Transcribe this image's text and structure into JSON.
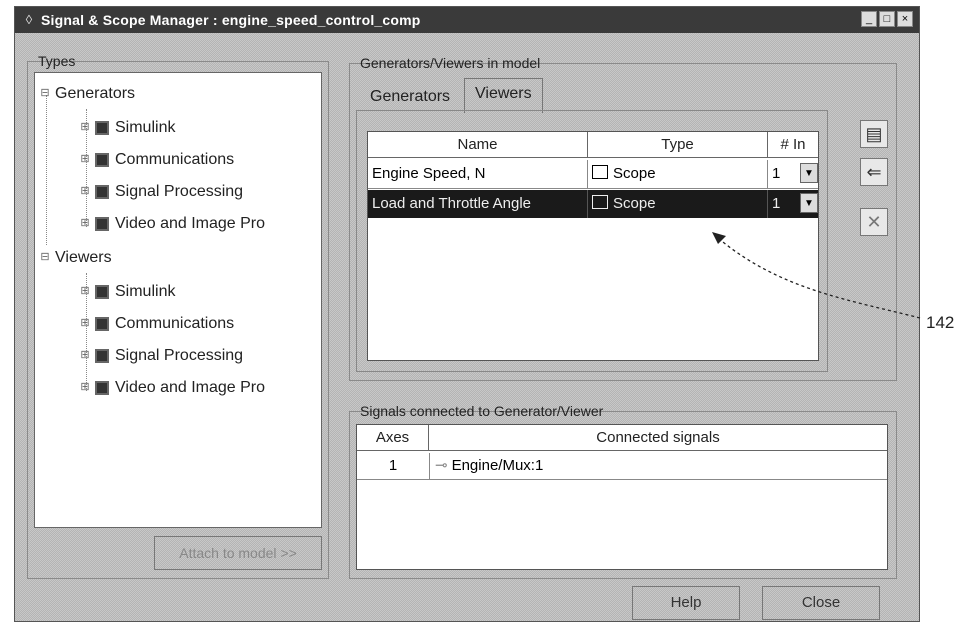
{
  "window": {
    "title": "Signal & Scope Manager : engine_speed_control_comp"
  },
  "types": {
    "legend": "Types",
    "tree": [
      {
        "label": "Generators",
        "children": [
          "Simulink",
          "Communications",
          "Signal Processing",
          "Video and Image Pro"
        ]
      },
      {
        "label": "Viewers",
        "children": [
          "Simulink",
          "Communications",
          "Signal Processing",
          "Video and Image Pro"
        ]
      }
    ],
    "attach_label": "Attach to model >>"
  },
  "gv": {
    "legend": "Generators/Viewers in model",
    "tabs": [
      "Generators",
      "Viewers"
    ],
    "active_tab": "Viewers",
    "columns": [
      "Name",
      "Type",
      "# In"
    ],
    "rows": [
      {
        "name": "Engine Speed, N",
        "type": "Scope",
        "in": "1",
        "selected": false
      },
      {
        "name": "Load and Throttle Angle",
        "type": "Scope",
        "in": "1",
        "selected": true
      }
    ],
    "side_buttons": [
      "new-viewer-icon",
      "connect-signal-icon",
      "delete-icon"
    ]
  },
  "signals": {
    "legend": "Signals connected to Generator/Viewer",
    "columns": [
      "Axes",
      "Connected signals"
    ],
    "rows": [
      {
        "axes": "1",
        "signal": "Engine/Mux:1"
      }
    ]
  },
  "buttons": {
    "help": "Help",
    "close": "Close"
  },
  "annotation": {
    "label": "142"
  }
}
